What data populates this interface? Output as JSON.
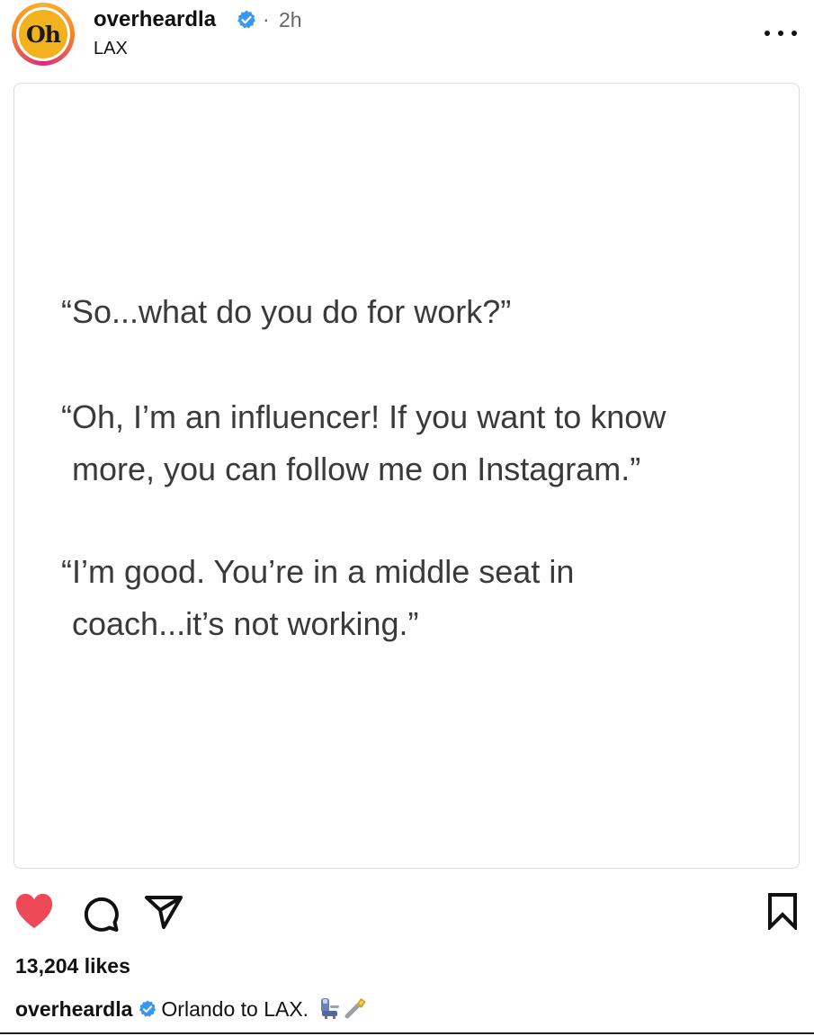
{
  "header": {
    "avatar_text": "Oh",
    "username": "overheardla",
    "separator": "·",
    "time": "2h",
    "location": "LAX"
  },
  "post": {
    "lines": [
      "“So...what do you do for work?”",
      "“Oh, I’m an influencer! If you want to know",
      "more, you can follow me on Instagram.”",
      "“I’m good. You’re in a middle seat in",
      "coach...it’s not working.”"
    ]
  },
  "actions": {
    "liked": true,
    "heart_color": "#ed4956"
  },
  "likes": {
    "text": "13,204 likes"
  },
  "caption": {
    "username": "overheardla",
    "text": "Orlando to LAX.",
    "emojis": [
      "seat-emoji",
      "seatbelt-emoji"
    ]
  },
  "colors": {
    "verified": "#3897f0",
    "avatar_bg": "#f2b21d"
  }
}
